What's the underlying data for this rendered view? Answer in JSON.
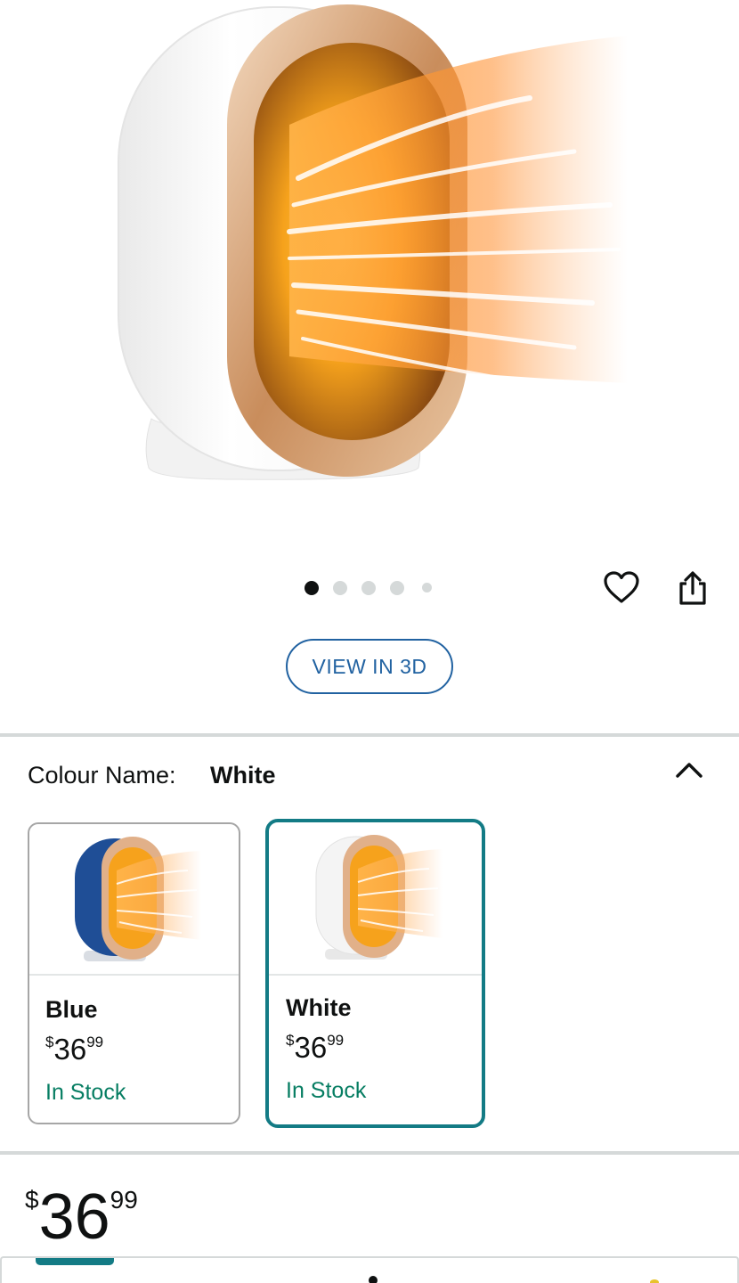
{
  "carousel": {
    "total_images": 5,
    "current_index": 0
  },
  "actions": {
    "view_3d_label": "VIEW IN 3D"
  },
  "colour": {
    "label": "Colour Name:",
    "selected": "White"
  },
  "swatches": [
    {
      "name": "Blue",
      "currency": "$",
      "price_whole": "36",
      "price_fraction": "99",
      "availability": "In Stock",
      "body_color": "#1f4e96"
    },
    {
      "name": "White",
      "currency": "$",
      "price_whole": "36",
      "price_fraction": "99",
      "availability": "In Stock",
      "body_color": "#f4f4f4"
    }
  ],
  "price": {
    "currency": "$",
    "whole": "36",
    "fraction": "99"
  },
  "colors": {
    "accent_teal": "#137b85",
    "link_blue": "#2162a1",
    "in_stock_green": "#067d62",
    "divider": "#d5d9d9"
  },
  "icons": {
    "favorite": "heart-icon",
    "share": "share-icon",
    "collapse": "chevron-up-icon"
  }
}
